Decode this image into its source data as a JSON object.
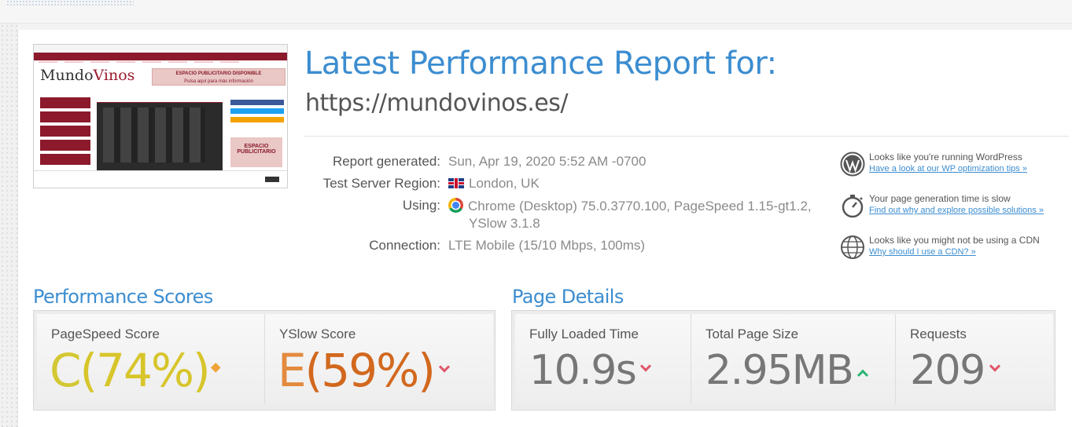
{
  "report": {
    "heading": "Latest Performance Report for:",
    "url": "https://mundovinos.es/"
  },
  "details": {
    "generated_label": "Report generated:",
    "generated_value": "Sun, Apr 19, 2020 5:52 AM -0700",
    "region_label": "Test Server Region:",
    "region_value": "London, UK",
    "using_label": "Using:",
    "using_value_line1": "Chrome (Desktop) 75.0.3770.100, PageSpeed 1.15-gt1.2,",
    "using_value_line2": "YSlow 3.1.8",
    "connection_label": "Connection:",
    "connection_value": "LTE Mobile (15/10 Mbps, 100ms)"
  },
  "tips": [
    {
      "icon": "wordpress-icon",
      "text": "Looks like you're running WordPress",
      "link": "Have a look at our WP optimization tips »"
    },
    {
      "icon": "stopwatch-icon",
      "text": "Your page generation time is slow",
      "link": "Find out why and explore possible solutions »"
    },
    {
      "icon": "globe-icon",
      "text": "Looks like you might not be using a CDN",
      "link": "Why should I use a CDN? »"
    }
  ],
  "thumbnail": {
    "logo_a": "Mundo",
    "logo_b": "Vinos",
    "banner_line1": "ESPACIO PUBLICITARIO DISPONIBLE",
    "banner_line2": "Pulsa aquí para más información",
    "side_ad": "ESPACIO PUBLICITARIO"
  },
  "performance": {
    "title": "Performance Scores",
    "pagespeed_label": "PageSpeed Score",
    "pagespeed_grade": "C",
    "pagespeed_value": "(74%)",
    "pagespeed_trend": "neutral",
    "yslow_label": "YSlow Score",
    "yslow_grade": "E",
    "yslow_value": "(59%)",
    "yslow_trend": "down"
  },
  "page_details": {
    "title": "Page Details",
    "load_label": "Fully Loaded Time",
    "load_value": "10.9s",
    "load_trend": "down",
    "size_label": "Total Page Size",
    "size_value": "2.95MB",
    "size_trend": "up",
    "requests_label": "Requests",
    "requests_value": "209",
    "requests_trend": "down"
  },
  "colors": {
    "accent": "#3c8dd0",
    "grade_c": "#d7c52a",
    "grade_e": "#d2681e",
    "trend_down": "#e0566a",
    "trend_up": "#2bb673",
    "trend_neutral": "#f0a33a"
  }
}
